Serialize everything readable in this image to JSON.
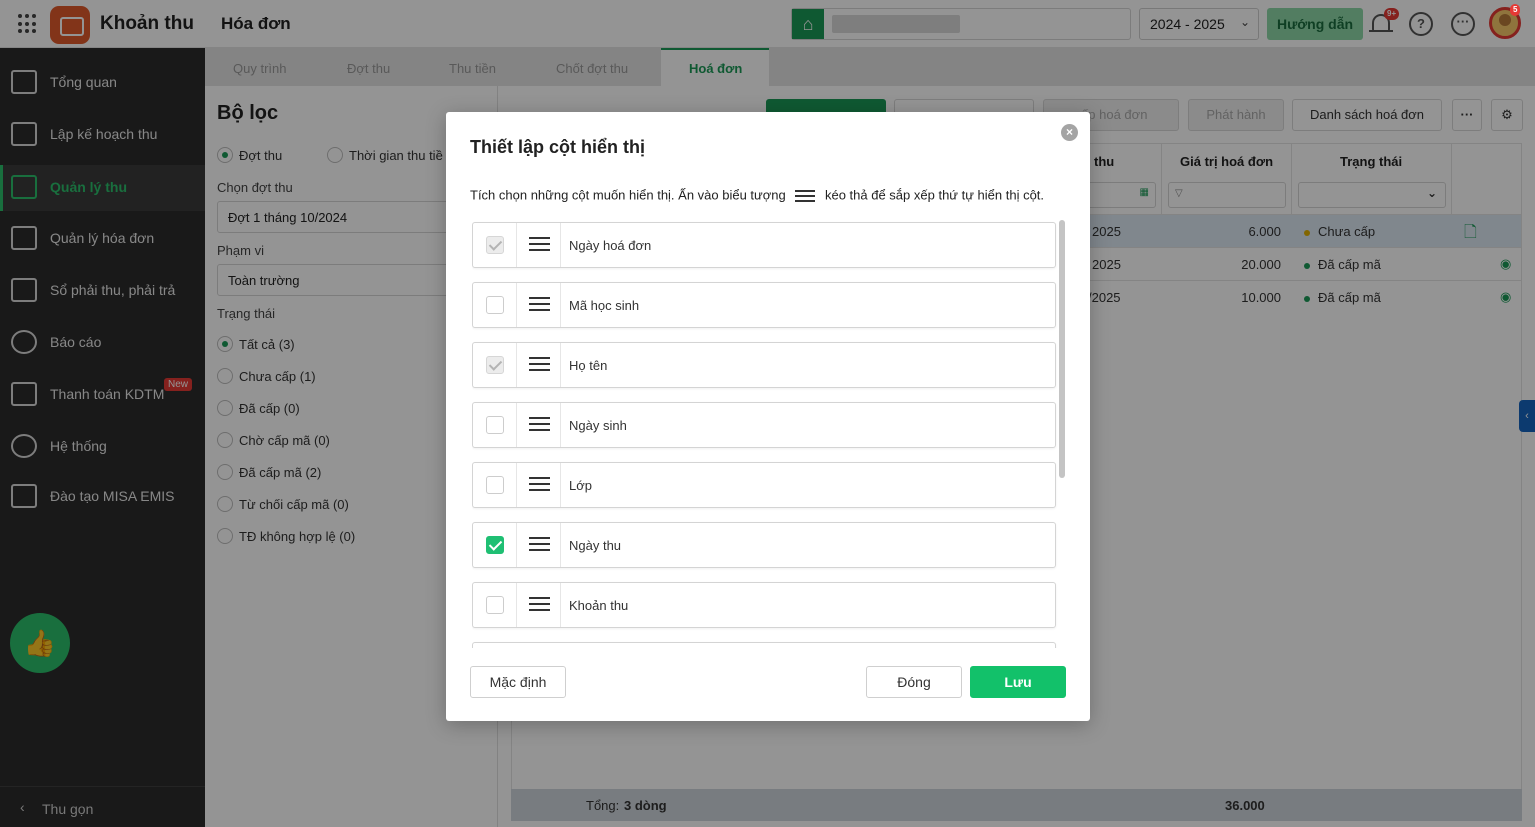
{
  "header": {
    "app_title": "Khoản thu",
    "page_title": "Hóa đơn",
    "school_year": "2024 - 2025",
    "guide_label": "Hướng dẫn",
    "notification_count": "9+",
    "avatar_badge": "5"
  },
  "sidebar": {
    "items": [
      {
        "label": "Tổng quan",
        "icon": "bar-chart-icon"
      },
      {
        "label": "Lập kế hoạch thu",
        "icon": "plan-icon"
      },
      {
        "label": "Quản lý thu",
        "icon": "money-icon"
      },
      {
        "label": "Quản lý hóa đơn",
        "icon": "invoice-icon"
      },
      {
        "label": "Sổ phải thu, phải trả",
        "icon": "ledger-icon"
      },
      {
        "label": "Báo cáo",
        "icon": "pie-chart-icon"
      },
      {
        "label": "Thanh toán KDTM",
        "icon": "payment-icon"
      },
      {
        "label": "Hệ thống",
        "icon": "gear-icon"
      },
      {
        "label": "Đào tạo MISA EMIS",
        "icon": "book-icon"
      }
    ],
    "new_badge": "New",
    "collapse_label": "Thu gọn"
  },
  "tabs": [
    "Quy trình",
    "Đợt thu",
    "Thu tiền",
    "Chốt đợt thu",
    "Hoá đơn"
  ],
  "filter": {
    "title": "Bộ lọc",
    "mode_options": [
      "Đợt thu",
      "Thời gian thu tiề"
    ],
    "period_label": "Chọn đợt thu",
    "period_value": "Đợt 1 tháng 10/2024",
    "scope_label": "Phạm vi",
    "scope_value": "Toàn trường",
    "status_label": "Trạng thái",
    "status_options": [
      "Tất cả (3)",
      "Chưa cấp (1)",
      "Đã cấp (0)",
      "Chờ cấp mã (0)",
      "Đã cấp mã (2)",
      "Từ chối cấp mã (0)",
      "TĐ không hợp lệ (0)"
    ]
  },
  "toolbar": {
    "issue_label": "Phát hành",
    "invoice_list_label": "Danh sách hoá đơn",
    "partial_label": "cấp hoá đơn"
  },
  "grid": {
    "col_thu": "thu",
    "col_value": "Giá trị hoá đơn",
    "col_status": "Trạng thái",
    "rows": [
      {
        "date": "2025",
        "value": "6.000",
        "status": "Chưa cấp",
        "status_color": "#e0b000"
      },
      {
        "date": "2025",
        "value": "20.000",
        "status": "Đã cấp mã",
        "status_color": "#1a9a57"
      },
      {
        "date": "/2025",
        "value": "10.000",
        "status": "Đã cấp mã",
        "status_color": "#1a9a57"
      }
    ],
    "footer_label": "Tổng:",
    "footer_count": "3 dòng",
    "footer_total": "36.000"
  },
  "modal": {
    "title": "Thiết lập cột hiển thị",
    "desc_before": "Tích chọn những cột muốn hiển thị. Ấn vào biểu tượng",
    "desc_after": "kéo thả để sắp xếp thứ tự hiển thị cột.",
    "columns": [
      {
        "label": "Ngày hoá đơn",
        "state": "disabled"
      },
      {
        "label": "Mã học sinh",
        "state": "unchecked"
      },
      {
        "label": "Họ tên",
        "state": "disabled"
      },
      {
        "label": "Ngày sinh",
        "state": "unchecked"
      },
      {
        "label": "Lớp",
        "state": "unchecked"
      },
      {
        "label": "Ngày thu",
        "state": "checked"
      },
      {
        "label": "Khoản thu",
        "state": "unchecked"
      }
    ],
    "default_label": "Mặc định",
    "close_label": "Đóng",
    "save_label": "Lưu"
  },
  "colors": {
    "brand_green": "#1a9a57",
    "save_green": "#12c16a",
    "sidebar_bg": "#2b2b2b"
  }
}
